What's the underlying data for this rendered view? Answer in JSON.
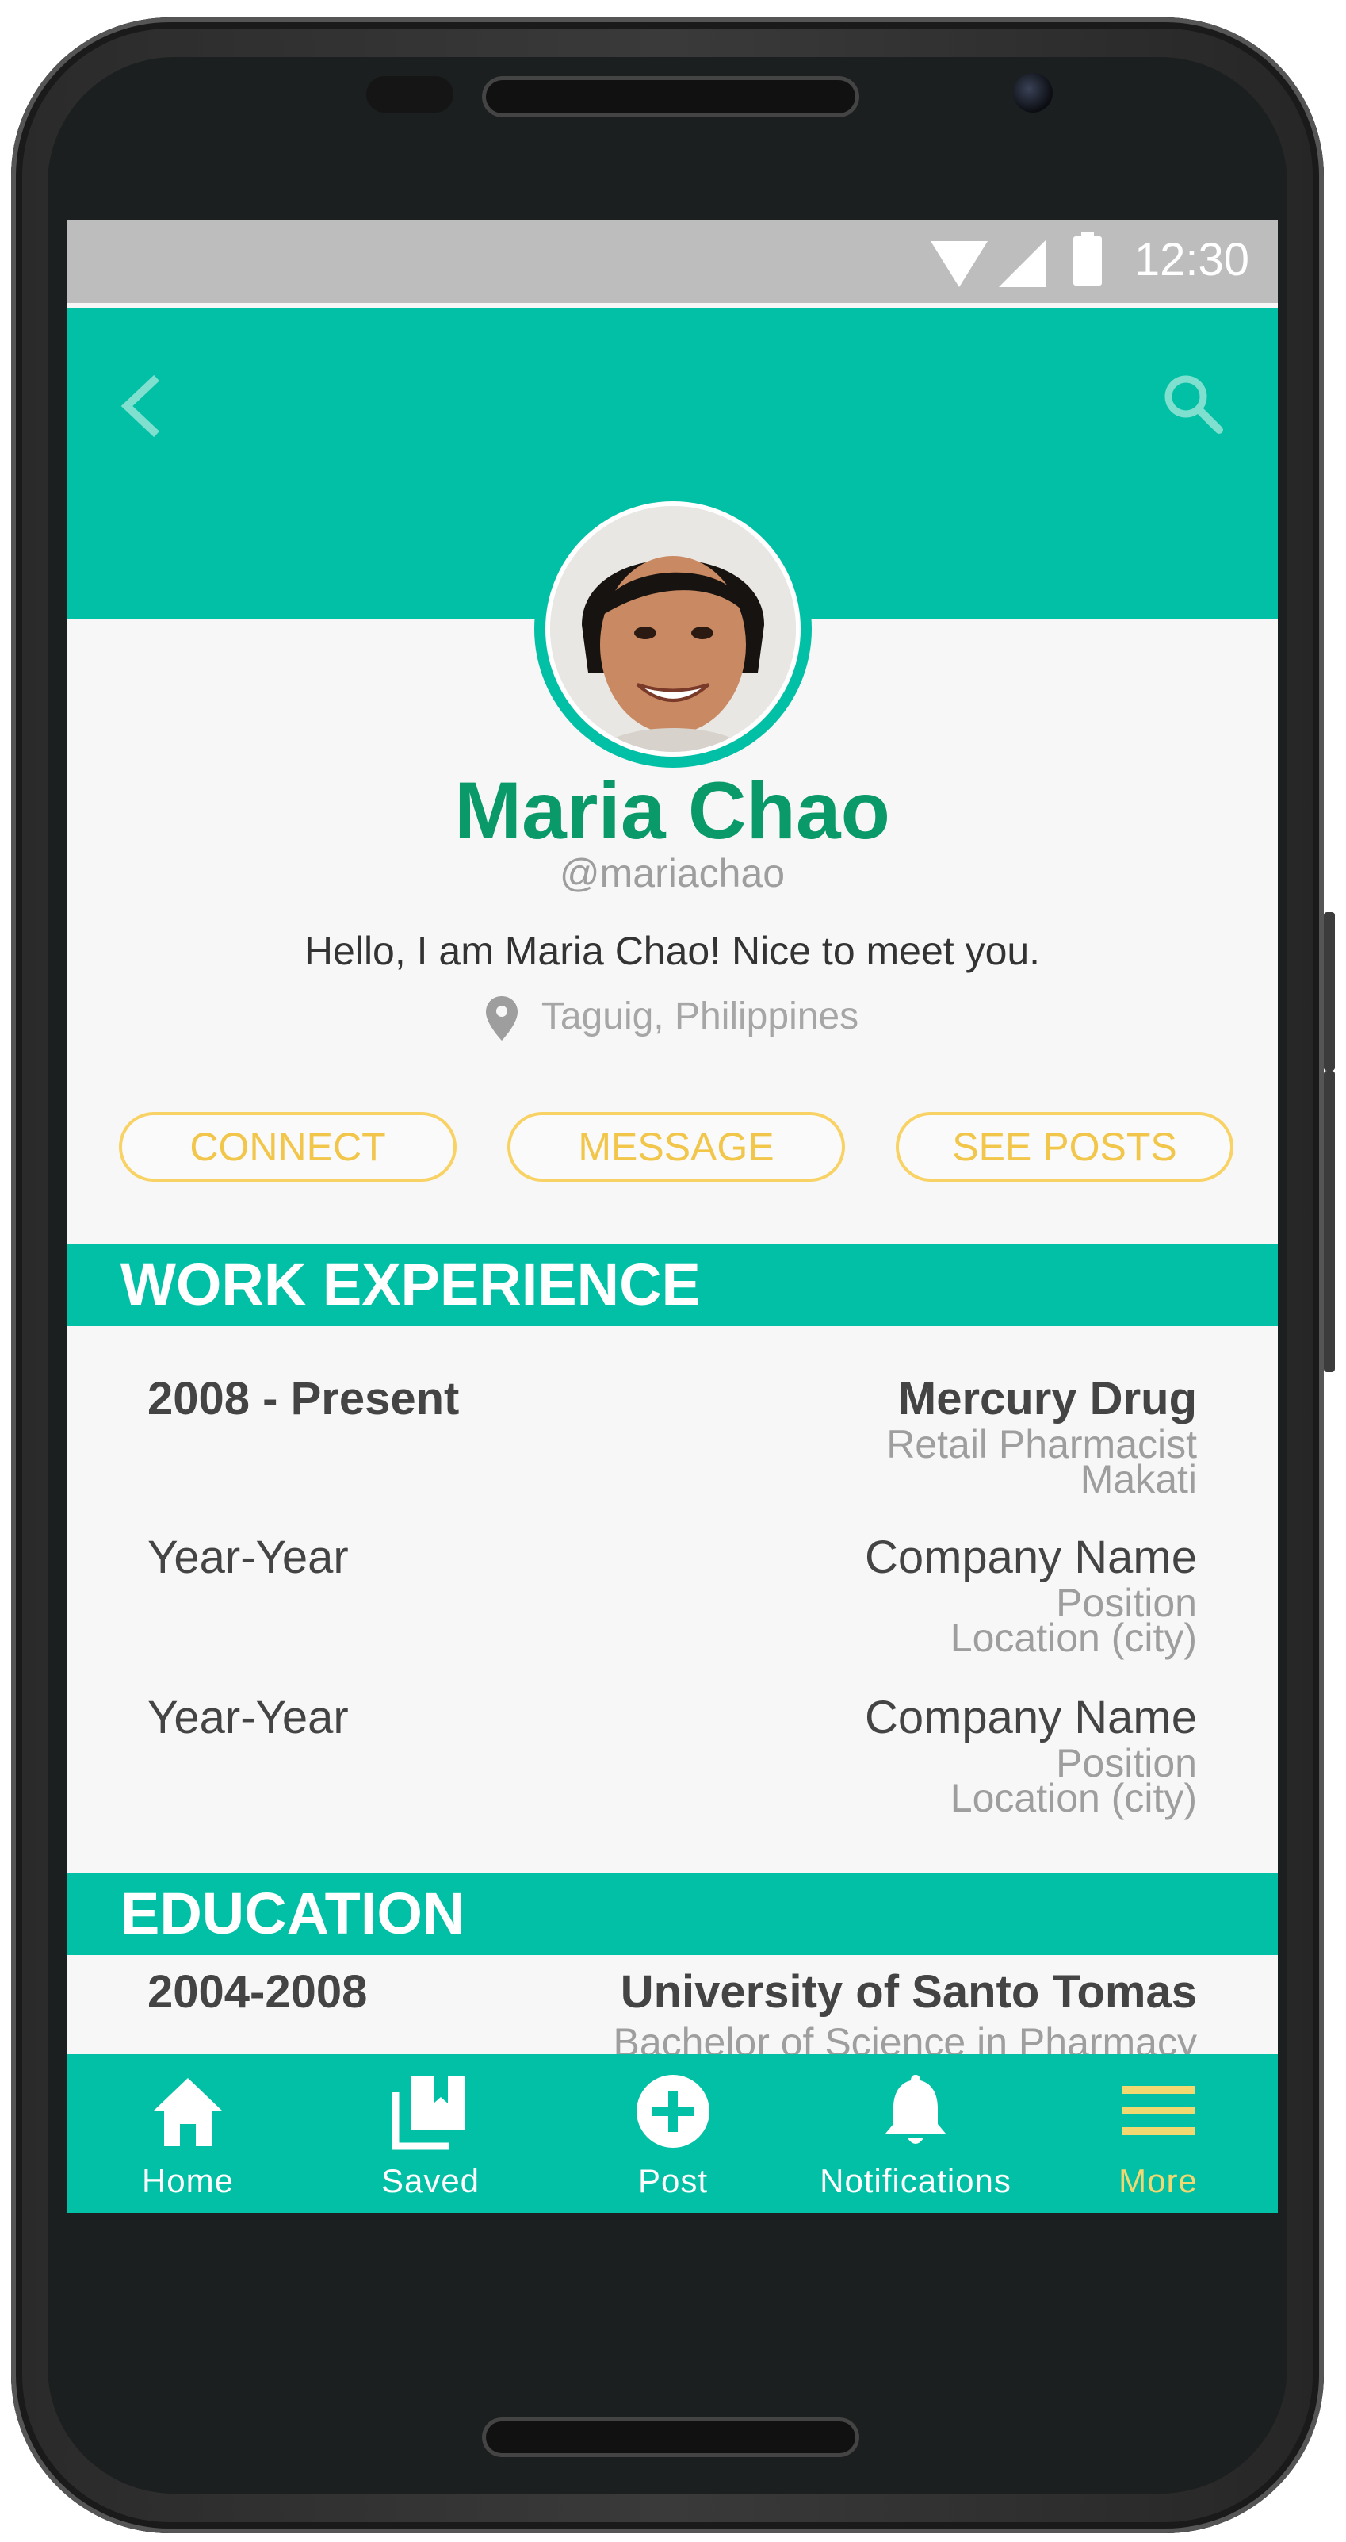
{
  "status_bar": {
    "time": "12:30"
  },
  "profile": {
    "name": "Maria Chao",
    "handle": "@mariachao",
    "bio": "Hello, I am Maria Chao! Nice to meet you.",
    "location": "Taguig, Philippines"
  },
  "actions": {
    "connect": "CONNECT",
    "message": "MESSAGE",
    "see_posts": "SEE POSTS"
  },
  "work_experience": {
    "title": "WORK EXPERIENCE",
    "items": [
      {
        "years": "2008 - Present",
        "company": "Mercury Drug",
        "position": "Retail Pharmacist",
        "city": "Makati"
      },
      {
        "years": "Year-Year",
        "company": "Company Name",
        "position": "Position",
        "city": "Location (city)"
      },
      {
        "years": "Year-Year",
        "company": "Company Name",
        "position": "Position",
        "city": "Location (city)"
      }
    ]
  },
  "education": {
    "title": "EDUCATION",
    "items": [
      {
        "years": "2004-2008",
        "school": "University of Santo Tomas",
        "degree": "Bachelor of Science in Pharmacy"
      }
    ]
  },
  "bottom_nav": [
    {
      "label": "Home",
      "icon": "home-icon"
    },
    {
      "label": "Saved",
      "icon": "saved-icon"
    },
    {
      "label": "Post",
      "icon": "add-circle-icon"
    },
    {
      "label": "Notifications",
      "icon": "bell-icon"
    },
    {
      "label": "More",
      "icon": "menu-icon",
      "active": true
    }
  ],
  "colors": {
    "primary": "#02c0a5",
    "accent": "#f2c64a",
    "name": "#0a9a6a"
  }
}
